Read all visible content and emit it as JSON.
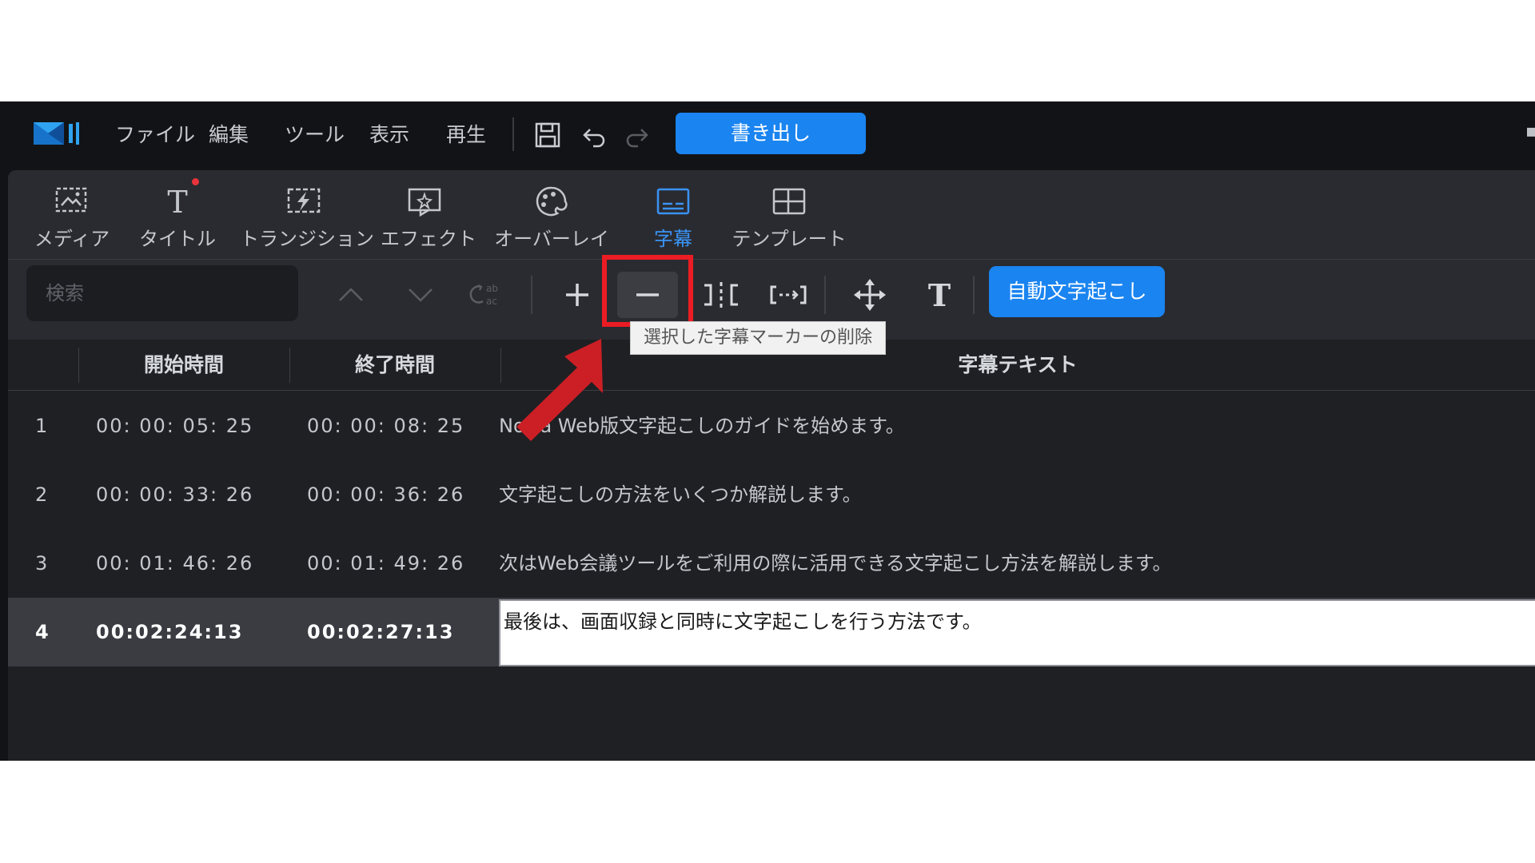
{
  "menu": {
    "file": "ファイル",
    "edit": "編集",
    "tools": "ツール",
    "view": "表示",
    "play": "再生"
  },
  "export_label": "書き出し",
  "room_tabs": [
    {
      "label": "メディア",
      "icon": "media-icon"
    },
    {
      "label": "タイトル",
      "icon": "title-icon"
    },
    {
      "label": "トランジション",
      "icon": "transition-icon"
    },
    {
      "label": "エフェクト",
      "icon": "effect-icon"
    },
    {
      "label": "オーバーレイ",
      "icon": "overlay-icon"
    },
    {
      "label": "字幕",
      "icon": "subtitle-icon",
      "active": true
    },
    {
      "label": "テンプレート",
      "icon": "template-icon"
    }
  ],
  "toolbar": {
    "search_placeholder": "検索",
    "auto_transcribe_label": "自動文字起こし",
    "tooltip": "選択した字幕マーカーの削除"
  },
  "table": {
    "columns": [
      "開始時間",
      "終了時間",
      "字幕テキスト"
    ],
    "rows": [
      {
        "num": "1",
        "start": "00: 00: 05: 25",
        "end": "00: 00: 08: 25",
        "text": "Notta Web版文字起こしのガイドを始めます。"
      },
      {
        "num": "2",
        "start": "00: 00: 33: 26",
        "end": "00: 00: 36: 26",
        "text": "文字起こしの方法をいくつか解説します。"
      },
      {
        "num": "3",
        "start": "00: 01: 46: 26",
        "end": "00: 01: 49: 26",
        "text": "次はWeb会議ツールをご利用の際に活用できる文字起こし方法を解説します。"
      },
      {
        "num": "4",
        "start": "00:02:24:13",
        "end": "00:02:27:13",
        "text": "最後は、画面収録と同時に文字起こしを行う方法です。",
        "selected": true
      }
    ]
  },
  "colors": {
    "accent": "#1a84f0",
    "active_tab": "#3a93f5",
    "highlight": "#ec1c24",
    "background": "#121316"
  }
}
